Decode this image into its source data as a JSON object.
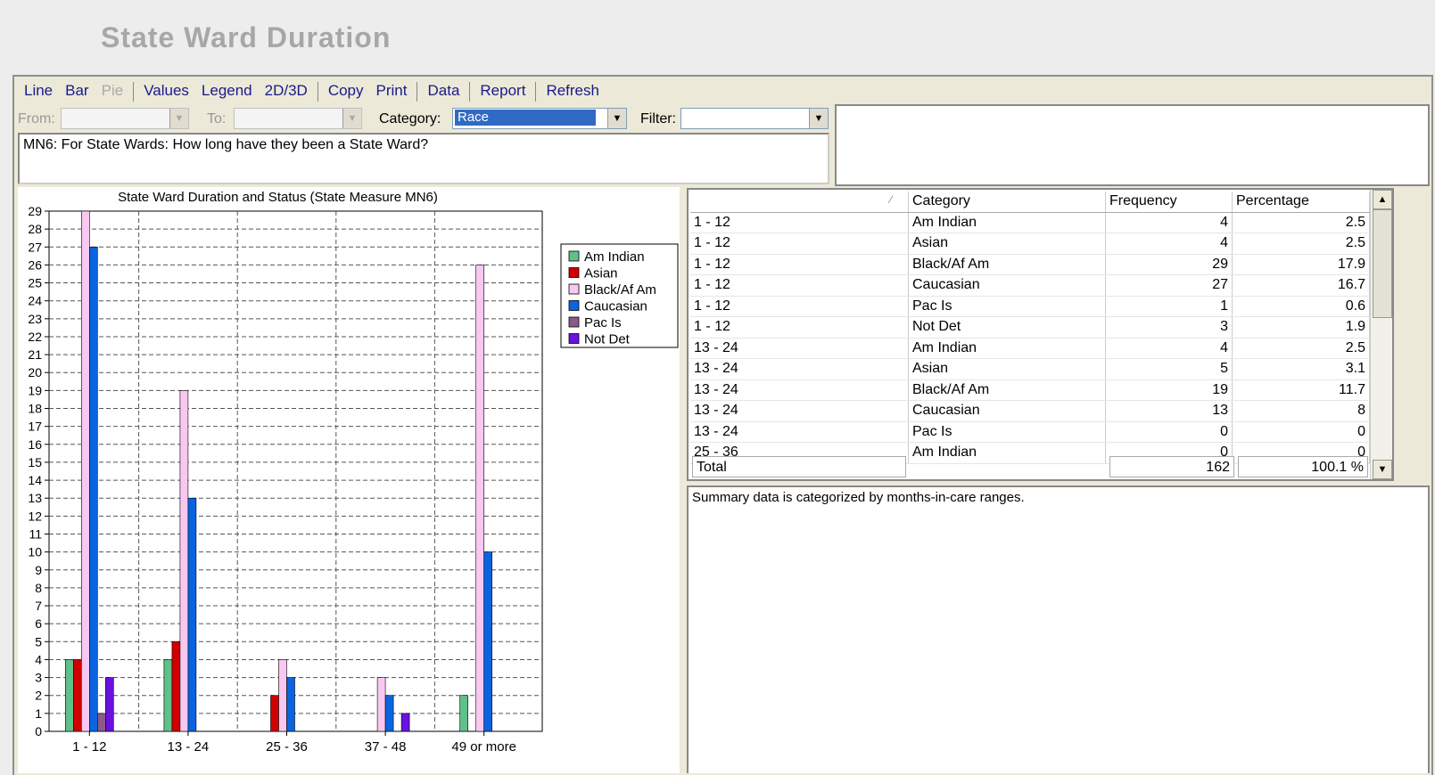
{
  "window": {
    "title": "State Ward Duration"
  },
  "toolbar": {
    "line": "Line",
    "bar": "Bar",
    "pie": "Pie",
    "values": "Values",
    "legend": "Legend",
    "dim": "2D/3D",
    "copy": "Copy",
    "print": "Print",
    "data": "Data",
    "report": "Report",
    "refresh": "Refresh"
  },
  "filters": {
    "from_label": "From:",
    "from_value": "",
    "to_label": "To:",
    "to_value": "",
    "category_label": "Category:",
    "category_value": "Race",
    "filter_label": "Filter:",
    "filter_value": ""
  },
  "question": "MN6: For State Wards:  How long have they been a State Ward?",
  "chart_data": {
    "type": "bar",
    "title": "State Ward Duration and Status (State Measure MN6)",
    "xlabel": "",
    "ylabel": "",
    "ylim": [
      0,
      29
    ],
    "yticks": [
      "0",
      "1",
      "2",
      "3",
      "4",
      "5",
      "6",
      "7",
      "8",
      "9",
      "10",
      "11",
      "12",
      "13",
      "14",
      "15",
      "16",
      "17",
      "18",
      "19",
      "20",
      "21",
      "22",
      "23",
      "24",
      "25",
      "26",
      "27",
      "28",
      "29"
    ],
    "grid": true,
    "legend_position": "right",
    "categories": [
      "1 - 12",
      "13 - 24",
      "25 - 36",
      "37 - 48",
      "49 or more"
    ],
    "series": [
      {
        "name": "Am Indian",
        "color": "#5fc08a",
        "values": [
          4,
          4,
          0,
          0,
          2
        ]
      },
      {
        "name": "Asian",
        "color": "#d00000",
        "values": [
          4,
          5,
          2,
          0,
          0
        ]
      },
      {
        "name": "Black/Af Am",
        "color": "#f8c8f0",
        "values": [
          29,
          19,
          4,
          3,
          26
        ]
      },
      {
        "name": "Caucasian",
        "color": "#0a64e0",
        "values": [
          27,
          13,
          3,
          2,
          10
        ]
      },
      {
        "name": "Pac Is",
        "color": "#8a5a8a",
        "values": [
          1,
          0,
          0,
          0,
          0
        ]
      },
      {
        "name": "Not Det",
        "color": "#6a10e0",
        "values": [
          3,
          0,
          0,
          1,
          0
        ]
      }
    ]
  },
  "grid": {
    "headers": [
      "",
      "Category",
      "Frequency",
      "Percentage"
    ],
    "rows": [
      [
        "1 - 12",
        "Am Indian",
        "4",
        "2.5"
      ],
      [
        "1 - 12",
        "Asian",
        "4",
        "2.5"
      ],
      [
        "1 - 12",
        "Black/Af Am",
        "29",
        "17.9"
      ],
      [
        "1 - 12",
        "Caucasian",
        "27",
        "16.7"
      ],
      [
        "1 - 12",
        "Pac Is",
        "1",
        "0.6"
      ],
      [
        "1 - 12",
        "Not Det",
        "3",
        "1.9"
      ],
      [
        "13 - 24",
        "Am Indian",
        "4",
        "2.5"
      ],
      [
        "13 - 24",
        "Asian",
        "5",
        "3.1"
      ],
      [
        "13 - 24",
        "Black/Af Am",
        "19",
        "11.7"
      ],
      [
        "13 - 24",
        "Caucasian",
        "13",
        "8"
      ],
      [
        "13 - 24",
        "Pac Is",
        "0",
        "0"
      ],
      [
        "25 - 36",
        "Am Indian",
        "0",
        "0"
      ]
    ],
    "total_label": "Total",
    "total_frequency": "162",
    "total_percentage": "100.1 %"
  },
  "summary": "Summary data is categorized by months-in-care ranges."
}
